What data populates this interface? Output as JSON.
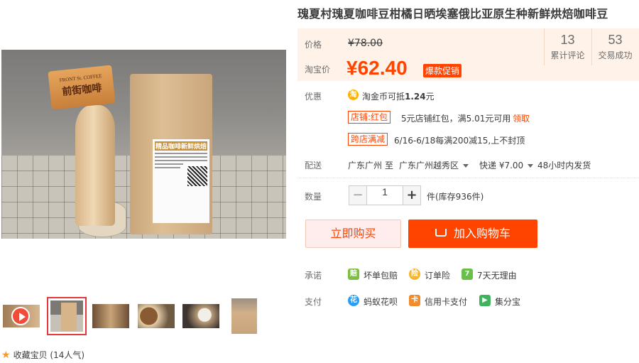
{
  "product": {
    "title": "瑰夏村瑰夏咖啡豆柑橘日晒埃塞俄比亚原生种新鲜烘焙咖啡豆"
  },
  "gallery": {
    "sign_en": "FRONT St. COFFEE",
    "sign_cn": "前街咖啡",
    "bag_label_title": "精品咖啡新鲜烘焙",
    "thumbnails": [
      "video",
      "product-bag",
      "coffee-beans",
      "coffee-cups",
      "latte",
      "bag-back"
    ],
    "selected_index": 1
  },
  "favorite": {
    "label": "收藏宝贝",
    "count": "(14人气)"
  },
  "price": {
    "original_label": "价格",
    "original_value": "¥78.00",
    "taobao_label": "淘宝价",
    "current_value": "¥62.40",
    "promo_tag": "爆款促销"
  },
  "stats": [
    {
      "num": "13",
      "label": "累计评论"
    },
    {
      "num": "53",
      "label": "交易成功"
    }
  ],
  "offers": {
    "label": "优惠",
    "coin_icon": "淘",
    "coin_text_prefix": "淘金币可抵",
    "coin_amount": "1.24",
    "coin_text_suffix": "元",
    "coupon_tag": "店铺:红包",
    "coupon_text": "5元店铺红包，满5.01元可用",
    "coupon_link": "领取",
    "cross_tag": "跨店满减",
    "cross_text": "6/16-6/18每满200减15,上不封顶"
  },
  "shipping": {
    "label": "配送",
    "from": "广东广州",
    "to_word": "至",
    "to": "广东广州越秀区",
    "method": "快递 ¥7.00",
    "time": "48小时内发货"
  },
  "quantity": {
    "label": "数量",
    "minus": "−",
    "value": "1",
    "plus": "+",
    "stock": "件(库存936件)"
  },
  "actions": {
    "buy_now": "立即购买",
    "add_cart": "加入购物车"
  },
  "promise": {
    "label": "承诺",
    "items": [
      "坏单包赔",
      "订单险",
      "7天无理由"
    ]
  },
  "payment": {
    "label": "支付",
    "items": [
      "蚂蚁花呗",
      "信用卡支付",
      "集分宝"
    ]
  },
  "colors": {
    "accent": "#ff4400",
    "price_bg": "#fff2e8",
    "buy_now_bg": "#ffeded"
  }
}
